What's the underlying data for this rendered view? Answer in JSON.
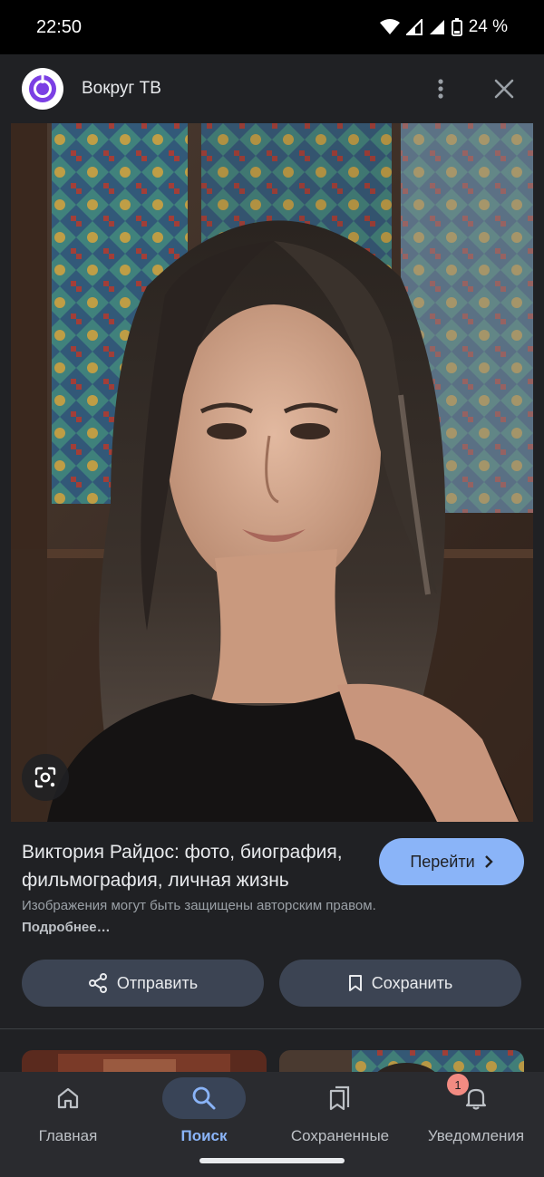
{
  "status_bar": {
    "time": "22:50",
    "battery": "24 %",
    "icons": [
      "wifi-icon",
      "signal-icon",
      "signal-icon",
      "battery-icon"
    ]
  },
  "header": {
    "site_name": "Вокруг ТВ",
    "logo_icon": "power-logo-icon",
    "menu_icon": "more-vert-icon",
    "close_icon": "close-icon"
  },
  "image": {
    "lens_icon": "google-lens-icon"
  },
  "result": {
    "title": "Виктория Райдос: фото, биография, фильмография, личная жизнь",
    "visit_label": "Перейти",
    "copyright_text": "Изображения могут быть защищены авторским правом.",
    "learn_more": "Подробнее…"
  },
  "actions": {
    "share_label": "Отправить",
    "save_label": "Сохранить"
  },
  "bottom_nav": {
    "items": [
      {
        "label": "Главная",
        "icon": "home-icon"
      },
      {
        "label": "Поиск",
        "icon": "search-icon"
      },
      {
        "label": "Сохраненные",
        "icon": "collections-icon"
      },
      {
        "label": "Уведомления",
        "icon": "bell-icon"
      }
    ],
    "notifications_badge": "1"
  },
  "colors": {
    "background": "#202124",
    "accent": "#8ab4f8",
    "button_dark": "#3c4453",
    "badge": "#f28b82"
  }
}
